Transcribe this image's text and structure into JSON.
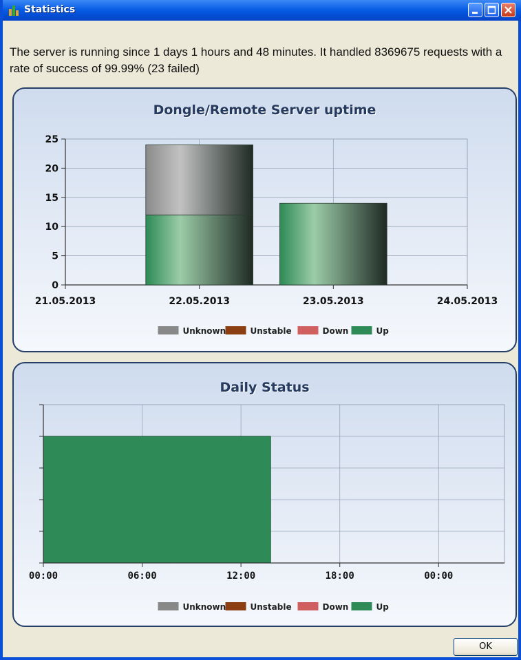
{
  "window": {
    "title": "Statistics"
  },
  "message": "The server is running since 1 days 1 hours and 48 minutes. It handled 8369675 requests with a rate of success of 99.99% (23 failed)",
  "ok_button": "OK",
  "colors": {
    "unknown": "#888888",
    "unstable": "#8b3f12",
    "down": "#d06060",
    "up": "#2e8b57"
  },
  "chart_data": [
    {
      "type": "bar",
      "stacked": true,
      "title": "Dongle/Remote Server uptime",
      "xlabel": "",
      "ylabel": "",
      "ylim": [
        0,
        25
      ],
      "yticks": [
        "0",
        "5",
        "10",
        "15",
        "20",
        "25"
      ],
      "xticks": [
        "21.05.2013",
        "22.05.2013",
        "23.05.2013",
        "24.05.2013"
      ],
      "categories": [
        "22.05.2013",
        "23.05.2013"
      ],
      "series": [
        {
          "name": "Unknown",
          "values": [
            12,
            0
          ]
        },
        {
          "name": "Unstable",
          "values": [
            0,
            0
          ]
        },
        {
          "name": "Down",
          "values": [
            0,
            0
          ]
        },
        {
          "name": "Up",
          "values": [
            12,
            14
          ]
        }
      ],
      "legend": [
        "Unknown",
        "Unstable",
        "Down",
        "Up"
      ],
      "legend_position": "bottom",
      "grid": true
    },
    {
      "type": "bar",
      "title": "Daily Status",
      "xticks": [
        "00:00",
        "06:00",
        "12:00",
        "18:00",
        "00:00"
      ],
      "x_range_hours": [
        0,
        28
      ],
      "segments": [
        {
          "status": "Up",
          "start_hour": 0,
          "end_hour": 13.8,
          "level": 0.8
        }
      ],
      "legend": [
        "Unknown",
        "Unstable",
        "Down",
        "Up"
      ],
      "legend_position": "bottom",
      "grid": true
    }
  ]
}
